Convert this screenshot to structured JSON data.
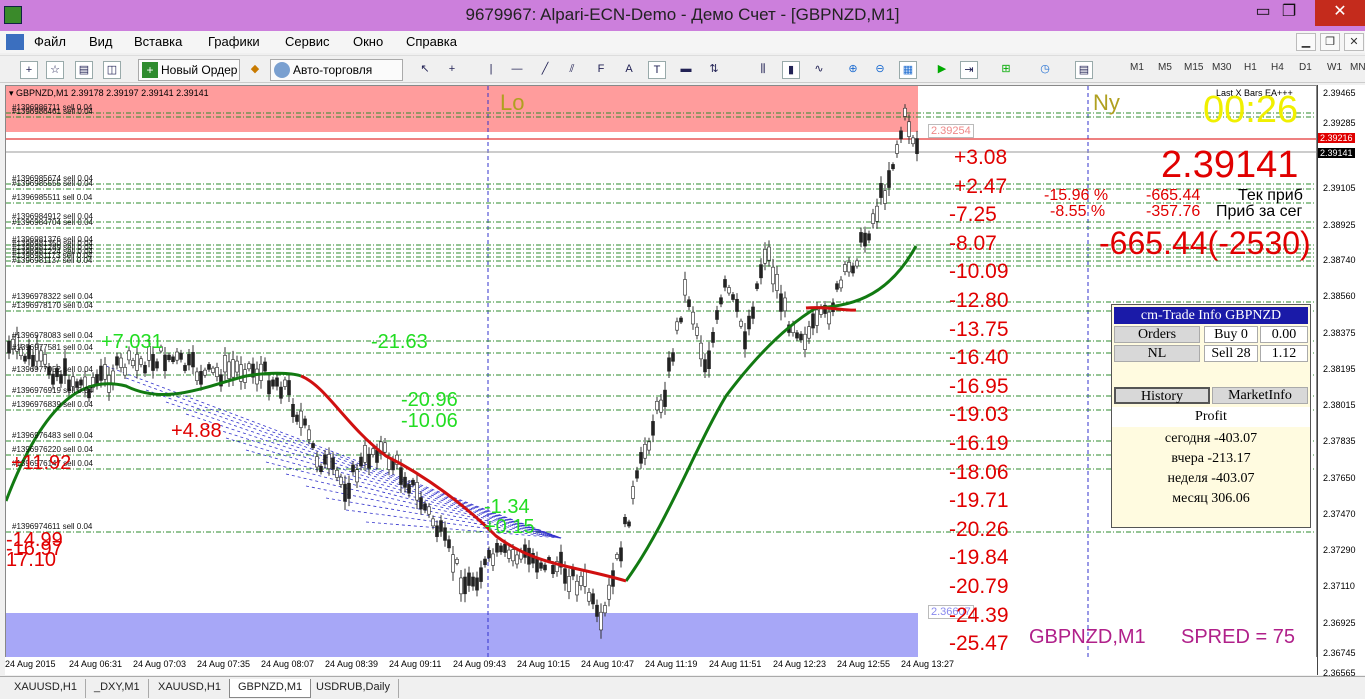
{
  "window": {
    "title": "9679967: Alpari-ECN-Demo - Демо Счет - [GBPNZD,M1]",
    "minimize": "▭",
    "maximize": "❐",
    "close": "✕"
  },
  "menu": {
    "items": [
      "Файл",
      "Вид",
      "Вставка",
      "Графики",
      "Сервис",
      "Окно",
      "Справка"
    ],
    "mdi_min": "▁",
    "mdi_restore": "❐",
    "mdi_close": "✕"
  },
  "toolbar": {
    "new_order": "Новый Ордер",
    "autotrading": "Авто-торговля",
    "timeframes": [
      "M1",
      "M5",
      "M15",
      "M30",
      "H1",
      "H4",
      "D1",
      "W1",
      "MN"
    ],
    "icons": [
      "new-chart-icon",
      "profiles-icon",
      "market-watch-icon",
      "navigator-icon",
      "new-order-icon",
      "metaeditor-icon",
      "autotrading-icon",
      "cursor-icon",
      "crosshair-icon",
      "vertical-line-icon",
      "horizontal-line-icon",
      "trendline-icon",
      "channel-icon",
      "fibonacci-icon",
      "text-icon",
      "text-label-icon",
      "rectangle-icon",
      "arrows-icon",
      "bar-chart-icon",
      "candles-icon",
      "line-chart-icon",
      "zoom-in-icon",
      "zoom-out-icon",
      "tile-icon",
      "autoscroll-icon",
      "chart-shift-icon",
      "indicators-icon",
      "periods-icon",
      "templates-icon"
    ]
  },
  "chart": {
    "symbol_header": "GBPNZD,M1  2.39178 2.39197 2.39141 2.39141",
    "indicator_name": "Last X Bars EA+++",
    "zone_top_label": "Lo",
    "zone_ny_label": "Ny",
    "timer": "00:26",
    "bid": "2.39141",
    "tek_pct": "-15.96 %",
    "tek_val": "-665.44",
    "tek_label": "Тек приб",
    "seg_pct": "-8.55 %",
    "seg_val": "-357.76",
    "seg_label": "Приб за сег",
    "total": "-665.44(-2530)",
    "bottom_label": "GBPNZD,M1",
    "spread_label": "SPRED = 75",
    "price_tag_top": "2.39254",
    "price_tag_bottom": "2.36607",
    "profit_ladder": [
      "+3.08",
      "+2.47",
      "-7.25",
      "-8.07",
      "-10.09",
      "-12.80",
      "-13.75",
      "-16.40",
      "-16.95",
      "-19.03",
      "-16.19",
      "-18.06",
      "-19.71",
      "-20.26",
      "-19.84",
      "-20.79",
      "-24.39",
      "-25.47"
    ],
    "green_labels": [
      "+7.031",
      "-21.63",
      "-20.96",
      "-10.06",
      "-1.34",
      "+0.15"
    ],
    "red_labels": [
      "+4.88",
      "+11.92",
      "-14.99",
      "-16.97",
      "17.10"
    ],
    "order_lines": [
      "#1396986711 sell 0.04",
      "#1396986461 sell 0.04",
      "#1396985674 sell 0.04",
      "#1396985555 sell 0.04",
      "#1396985511 sell 0.04",
      "#1396984912 sell 0.04",
      "#1396984704 sell 0.04",
      "#1396981376 sell 0.04",
      "#1396981350 sell 0.04",
      "#1396981289 sell 0.04",
      "#1396981224 sell 0.04",
      "#1396981173 sell 0.04",
      "#1396981137 sell 0.04",
      "#1396978322 sell 0.04",
      "#1396978170 sell 0.04",
      "#1396978083 sell 0.04",
      "#1396977581 sell 0.04",
      "#1396977052 sell 0.04",
      "#1396976919 sell 0.04",
      "#1396976839 sell 0.04",
      "#1396976483 sell 0.04",
      "#1396976220 sell 0.04",
      "#1396976147 sell 0.04",
      "#1396974611 sell 0.04"
    ]
  },
  "price_axis": [
    "2.39465",
    "2.39285",
    "2.39216",
    "2.39141",
    "2.39105",
    "2.38925",
    "2.38740",
    "2.38560",
    "2.38375",
    "2.38195",
    "2.38015",
    "2.37835",
    "2.37650",
    "2.37470",
    "2.37290",
    "2.37110",
    "2.36925",
    "2.36745",
    "2.36565",
    "2.36385"
  ],
  "time_axis": [
    "24 Aug 2015",
    "24 Aug 06:31",
    "24 Aug 07:03",
    "24 Aug 07:35",
    "24 Aug 08:07",
    "24 Aug 08:39",
    "24 Aug 09:11",
    "24 Aug 09:43",
    "24 Aug 10:15",
    "24 Aug 10:47",
    "24 Aug 11:19",
    "24 Aug 11:51",
    "24 Aug 12:23",
    "24 Aug 12:55",
    "24 Aug 13:27"
  ],
  "trade_panel": {
    "title": "cm-Trade Info GBPNZD",
    "orders_btn": "Orders",
    "buy": "Buy 0",
    "buy_val": "0.00",
    "nl_btn": "NL",
    "sell": "Sell 28",
    "sell_val": "1.12",
    "history_btn": "History",
    "marketinfo_btn": "MarketInfo",
    "profit_label": "Profit",
    "today": "сегодня -403.07",
    "yesterday": "вчера -213.17",
    "week": "неделя -403.07",
    "month": "месяц 306.06"
  },
  "tabs": [
    "XAUUSD,H1",
    "_DXY,M1",
    "XAUUSD,H1",
    "GBPNZD,M1",
    "USDRUB,Daily"
  ],
  "colors": {
    "title_bg": "#cc7fdc",
    "zone_red": "#ff9c9c",
    "zone_blue": "#a7a7f7",
    "profit_red": "#e00000",
    "profit_green": "#22dd22",
    "timer_yellow": "#f0f000",
    "ma_green": "#127a12",
    "ma_red": "#d01010"
  }
}
